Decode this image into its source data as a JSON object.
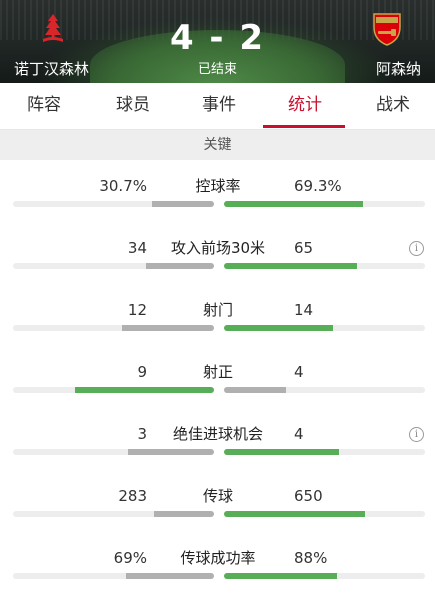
{
  "match": {
    "home_team": "诺丁汉森林",
    "away_team": "阿森纳",
    "score": "4 - 2",
    "status": "已结束"
  },
  "tabs": [
    {
      "label": "阵容",
      "active": false
    },
    {
      "label": "球员",
      "active": false
    },
    {
      "label": "事件",
      "active": false
    },
    {
      "label": "统计",
      "active": true
    },
    {
      "label": "战术",
      "active": false
    }
  ],
  "section_title": "关键",
  "colors": {
    "accent": "#c8102e",
    "leading": "#58ae57",
    "trailing": "#b0b0b0"
  },
  "stats": [
    {
      "label": "控球率",
      "home": "30.7%",
      "away": "69.3%",
      "home_share": 0.307,
      "away_share": 0.693,
      "leader": "away",
      "info": false
    },
    {
      "label": "攻入前场30米",
      "home": "34",
      "away": "65",
      "home_share": 0.34,
      "away_share": 0.66,
      "leader": "away",
      "info": true
    },
    {
      "label": "射门",
      "home": "12",
      "away": "14",
      "home_share": 0.46,
      "away_share": 0.54,
      "leader": "away",
      "info": false
    },
    {
      "label": "射正",
      "home": "9",
      "away": "4",
      "home_share": 0.69,
      "away_share": 0.31,
      "leader": "home",
      "info": false
    },
    {
      "label": "绝佳进球机会",
      "home": "3",
      "away": "4",
      "home_share": 0.43,
      "away_share": 0.57,
      "leader": "away",
      "info": true
    },
    {
      "label": "传球",
      "home": "283",
      "away": "650",
      "home_share": 0.3,
      "away_share": 0.7,
      "leader": "away",
      "info": false
    },
    {
      "label": "传球成功率",
      "home": "69%",
      "away": "88%",
      "home_share": 0.44,
      "away_share": 0.56,
      "leader": "away",
      "info": false
    }
  ]
}
